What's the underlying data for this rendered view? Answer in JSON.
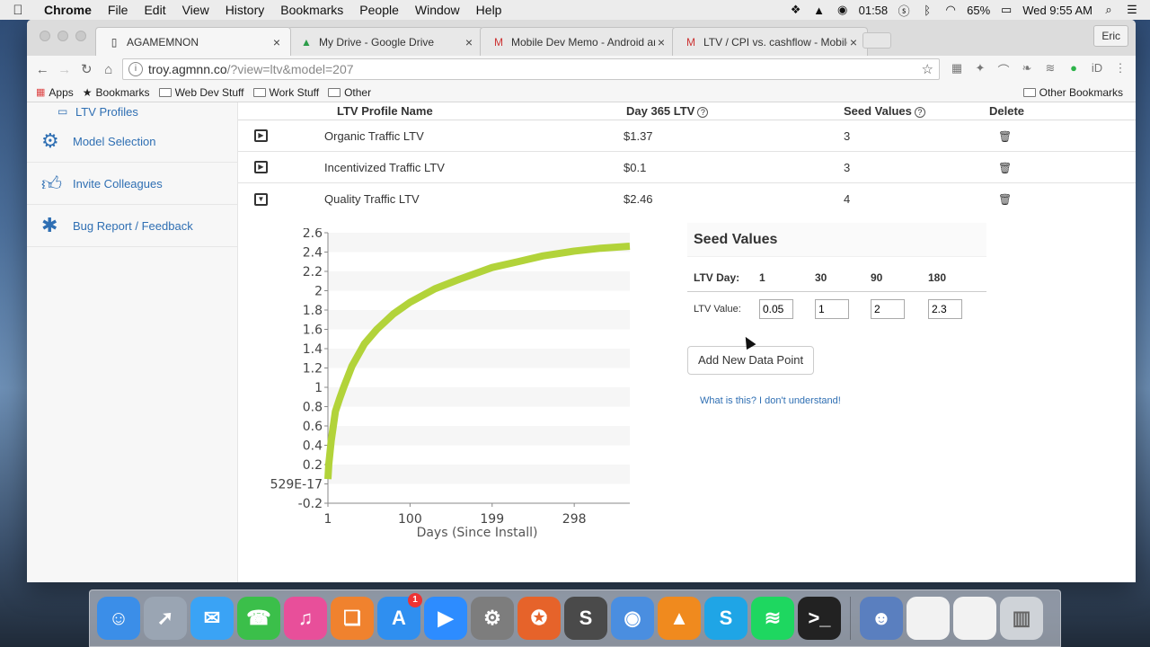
{
  "menubar": {
    "app": "Chrome",
    "items": [
      "File",
      "Edit",
      "View",
      "History",
      "Bookmarks",
      "People",
      "Window",
      "Help"
    ],
    "clock_small": "01:58",
    "battery": "65%",
    "datetime": "Wed 9:55 AM"
  },
  "browser": {
    "tabs": [
      {
        "title": "AGAMEMNON",
        "icon": "page-icon"
      },
      {
        "title": "My Drive - Google Drive",
        "icon": "drive-icon"
      },
      {
        "title": "Mobile Dev Memo - Android an",
        "icon": "gmail-icon"
      },
      {
        "title": "LTV / CPI vs. cashflow - Mobile",
        "icon": "gmail-icon"
      }
    ],
    "profile": "Eric",
    "url_host": "troy.agmnn.co",
    "url_rest": "/?view=ltv&model=207",
    "bookmarks": {
      "apps": "Apps",
      "bookmarks": "Bookmarks",
      "folders": [
        "Web Dev Stuff",
        "Work Stuff",
        "Other"
      ],
      "other": "Other Bookmarks"
    }
  },
  "sidebar": {
    "items": [
      {
        "label": "LTV Profiles",
        "icon": "card-icon"
      },
      {
        "label": "Model Selection",
        "icon": "gears-icon"
      },
      {
        "label": "Invite Colleagues",
        "icon": "thumbs-up-icon"
      },
      {
        "label": "Bug Report / Feedback",
        "icon": "bug-icon"
      }
    ]
  },
  "table": {
    "headers": {
      "name": "LTV Profile Name",
      "ltv": "Day 365 LTV",
      "seed": "Seed Values",
      "delete": "Delete"
    },
    "rows": [
      {
        "name": "Organic Traffic LTV",
        "ltv": "$1.37",
        "seed": "3",
        "expanded": false
      },
      {
        "name": "Incentivized Traffic LTV",
        "ltv": "$0.1",
        "seed": "3",
        "expanded": false
      },
      {
        "name": "Quality Traffic LTV",
        "ltv": "$2.46",
        "seed": "4",
        "expanded": true
      }
    ]
  },
  "seed_panel": {
    "title": "Seed Values",
    "day_label": "LTV Day:",
    "value_label": "LTV Value:",
    "days": [
      "1",
      "30",
      "90",
      "180"
    ],
    "values": [
      "0.05",
      "1",
      "2",
      "2.3"
    ],
    "add_button": "Add New Data Point",
    "help_link": "What is this? I don't understand!"
  },
  "chart_data": {
    "type": "line",
    "xlabel": "Days (Since Install)",
    "ylabel": "",
    "xlim": [
      1,
      365
    ],
    "ylim": [
      -0.2,
      2.6
    ],
    "x_ticks": [
      {
        "v": 1,
        "label": "1"
      },
      {
        "v": 100,
        "label": "100"
      },
      {
        "v": 199,
        "label": "199"
      },
      {
        "v": 298,
        "label": "298"
      }
    ],
    "y_ticks": [
      {
        "v": 2.6,
        "label": "2.6"
      },
      {
        "v": 2.4,
        "label": "2.4"
      },
      {
        "v": 2.2,
        "label": "2.2"
      },
      {
        "v": 2.0,
        "label": "2"
      },
      {
        "v": 1.8,
        "label": "1.8"
      },
      {
        "v": 1.6,
        "label": "1.6"
      },
      {
        "v": 1.4,
        "label": "1.4"
      },
      {
        "v": 1.2,
        "label": "1.2"
      },
      {
        "v": 1.0,
        "label": "1"
      },
      {
        "v": 0.8,
        "label": "0.8"
      },
      {
        "v": 0.6,
        "label": "0.6"
      },
      {
        "v": 0.4,
        "label": "0.4"
      },
      {
        "v": 0.2,
        "label": "0.2"
      },
      {
        "v": 0.0,
        "label": "529E-17"
      },
      {
        "v": -0.2,
        "label": "-0.2"
      }
    ],
    "series": [
      {
        "color": "#b2d33a",
        "x": [
          1,
          2,
          5,
          10,
          15,
          20,
          30,
          45,
          60,
          80,
          100,
          130,
          160,
          199,
          230,
          260,
          298,
          330,
          365
        ],
        "y": [
          0.05,
          0.2,
          0.45,
          0.75,
          0.88,
          1.0,
          1.22,
          1.45,
          1.6,
          1.76,
          1.88,
          2.02,
          2.12,
          2.24,
          2.3,
          2.36,
          2.41,
          2.44,
          2.46
        ]
      }
    ]
  },
  "dock": {
    "items": [
      {
        "name": "finder",
        "color": "#3b8ee8",
        "glyph": "☺"
      },
      {
        "name": "launchpad",
        "color": "#9aa5b3",
        "glyph": "➚"
      },
      {
        "name": "messages",
        "color": "#3aa3f5",
        "glyph": "✉"
      },
      {
        "name": "facetime",
        "color": "#3bbf4a",
        "glyph": "☎"
      },
      {
        "name": "itunes",
        "color": "#e84f9a",
        "glyph": "♫"
      },
      {
        "name": "ibooks",
        "color": "#f0822e",
        "glyph": "❏"
      },
      {
        "name": "app-store",
        "color": "#2f8ff0",
        "glyph": "A",
        "badge": "1"
      },
      {
        "name": "zoom",
        "color": "#2d8cff",
        "glyph": "▶"
      },
      {
        "name": "system-preferences",
        "color": "#7d7d7d",
        "glyph": "⚙"
      },
      {
        "name": "firefox",
        "color": "#e6632a",
        "glyph": "✪"
      },
      {
        "name": "sublime",
        "color": "#4a4a4a",
        "glyph": "S"
      },
      {
        "name": "chrome",
        "color": "#4a8ee0",
        "glyph": "◉"
      },
      {
        "name": "vlc",
        "color": "#f08a1e",
        "glyph": "▲"
      },
      {
        "name": "skype",
        "color": "#1fa5e6",
        "glyph": "S"
      },
      {
        "name": "spotify",
        "color": "#1ed760",
        "glyph": "≋"
      },
      {
        "name": "terminal",
        "color": "#222222",
        "glyph": ">_"
      }
    ],
    "right_items": [
      {
        "name": "game",
        "color": "#5a7fbf",
        "glyph": "☻"
      },
      {
        "name": "window-thumb-1",
        "color": "#f2f2f2",
        "glyph": ""
      },
      {
        "name": "window-thumb-2",
        "color": "#f2f2f2",
        "glyph": ""
      },
      {
        "name": "trash",
        "color": "#cfd3d8",
        "glyph": "▥"
      }
    ]
  }
}
